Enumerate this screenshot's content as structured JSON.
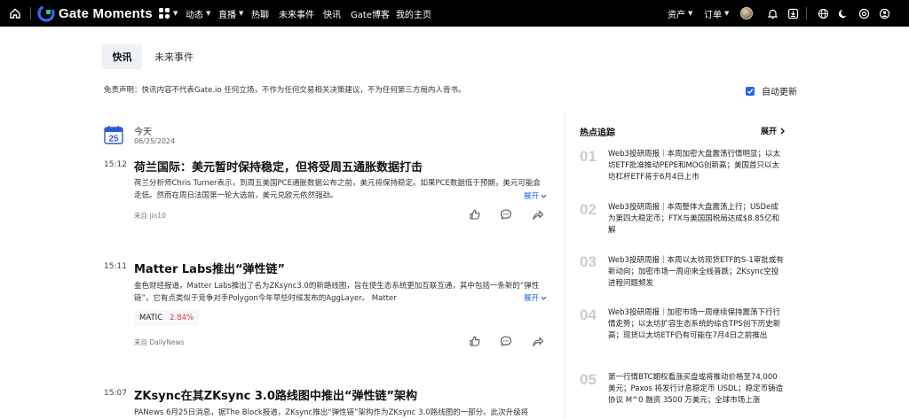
{
  "brand": {
    "name": "Gate Moments"
  },
  "nav": {
    "items": [
      {
        "label": "动态",
        "caret": true
      },
      {
        "label": "直播",
        "caret": true
      },
      {
        "label": "热聊",
        "caret": false
      },
      {
        "label": "未来事件",
        "caret": false
      },
      {
        "label": "快讯",
        "caret": false
      },
      {
        "label": "Gate博客",
        "caret": false
      },
      {
        "label": "我的主页",
        "caret": false
      }
    ],
    "right": {
      "assets": "资产",
      "orders": "订单"
    }
  },
  "tabs": [
    {
      "label": "快讯",
      "active": true
    },
    {
      "label": "未来事件",
      "active": false
    }
  ],
  "disclaimer": "免责声明：快讯内容不代表Gate.io 任何立场，不作为任何交易相关决策建议，不为任何第三方局内人背书。",
  "auto_update": {
    "label": "自动更新",
    "checked": true
  },
  "date_block": {
    "day": "25",
    "today": "今天",
    "date": "06/25/2024"
  },
  "feed": [
    {
      "time": "15:12",
      "title": "荷兰国际：美元暂时保持稳定，但将受周五通胀数据打击",
      "body": "荷兰分析师Chris Turner表示，到周五美国PCE通胀数据公布之前，美元将保持稳定。如果PCE数据低于预期，美元可能会走低。然而在周日法国第一轮大选前，美元兑欧元依然强劲。",
      "expand": "展开",
      "source": "来自 jin10"
    },
    {
      "time": "15:11",
      "title": "Matter Labs推出“弹性链”",
      "body": "金色财经报道，Matter Labs推出了名为ZKsync3.0的新路线图，旨在使生态系统更加互联互通，其中包括一条新的“弹性链”，它有点类似于竞争对手Polygon今年早些时候发布的AggLayer。 Matter",
      "expand": "展开",
      "tag": {
        "symbol": "MATIC",
        "change": "2.84%"
      },
      "source": "来自 DailyNews"
    },
    {
      "time": "15:07",
      "title": "ZKsync在其ZKsync 3.0路线图中推出“弹性链”架构",
      "body": "PANews 6月25日消息，据The Block报道，ZKsync推出“弹性链”架构作为ZKsync 3.0路线图的一部分。此次升级将"
    }
  ],
  "hot": {
    "title": "热点追踪",
    "expand": "展开",
    "items": [
      {
        "num": "01",
        "text": "Web3投研周报｜本周加密大盘震荡行情明显；以太坊ETF批准推动PEPE和MOG创新高；美国首只以太坊杠杆ETF将于6月4日上市"
      },
      {
        "num": "02",
        "text": "Web3投研周报｜本周整体大盘震荡上行；USDe成为第四大稳定币；FTX与美国国税局达成$8.85亿和解"
      },
      {
        "num": "03",
        "text": "Web3投研周报｜本周以太坊现货ETF的S-1审批或有新动向；加密市场一周迎来全线普跌；ZKsync空投进程问题频发"
      },
      {
        "num": "04",
        "text": "Web3投研周报｜加密市场一周继续保持震荡下行行情走势；以太坊扩容生态系统的综合TPS创下历史新高；现货以太坊ETF仍有可能在7月4日之前推出"
      },
      {
        "num": "05",
        "text": "第一行情BTC期权看涨买盘或将推动价格至74,000 美元；Paxos 将发行计息稳定币 USDL；稳定币铸造协议 M^0 融资 3500 万美元；全球市场上涨"
      }
    ]
  },
  "icons": {
    "home": "home-icon",
    "grid": "grid-icon",
    "bell": "bell-icon",
    "download": "download-icon",
    "globe": "globe-icon",
    "theme": "moon-icon",
    "settings": "settings-icon",
    "profile": "profile-icon",
    "calendar": "calendar-icon",
    "like": "thumbs-up-icon",
    "comment": "comment-icon",
    "share": "share-icon"
  },
  "colors": {
    "topbar": "#000000",
    "accent": "#2463eb",
    "up": "#d23d3d",
    "rank": "#c9ccd2"
  }
}
